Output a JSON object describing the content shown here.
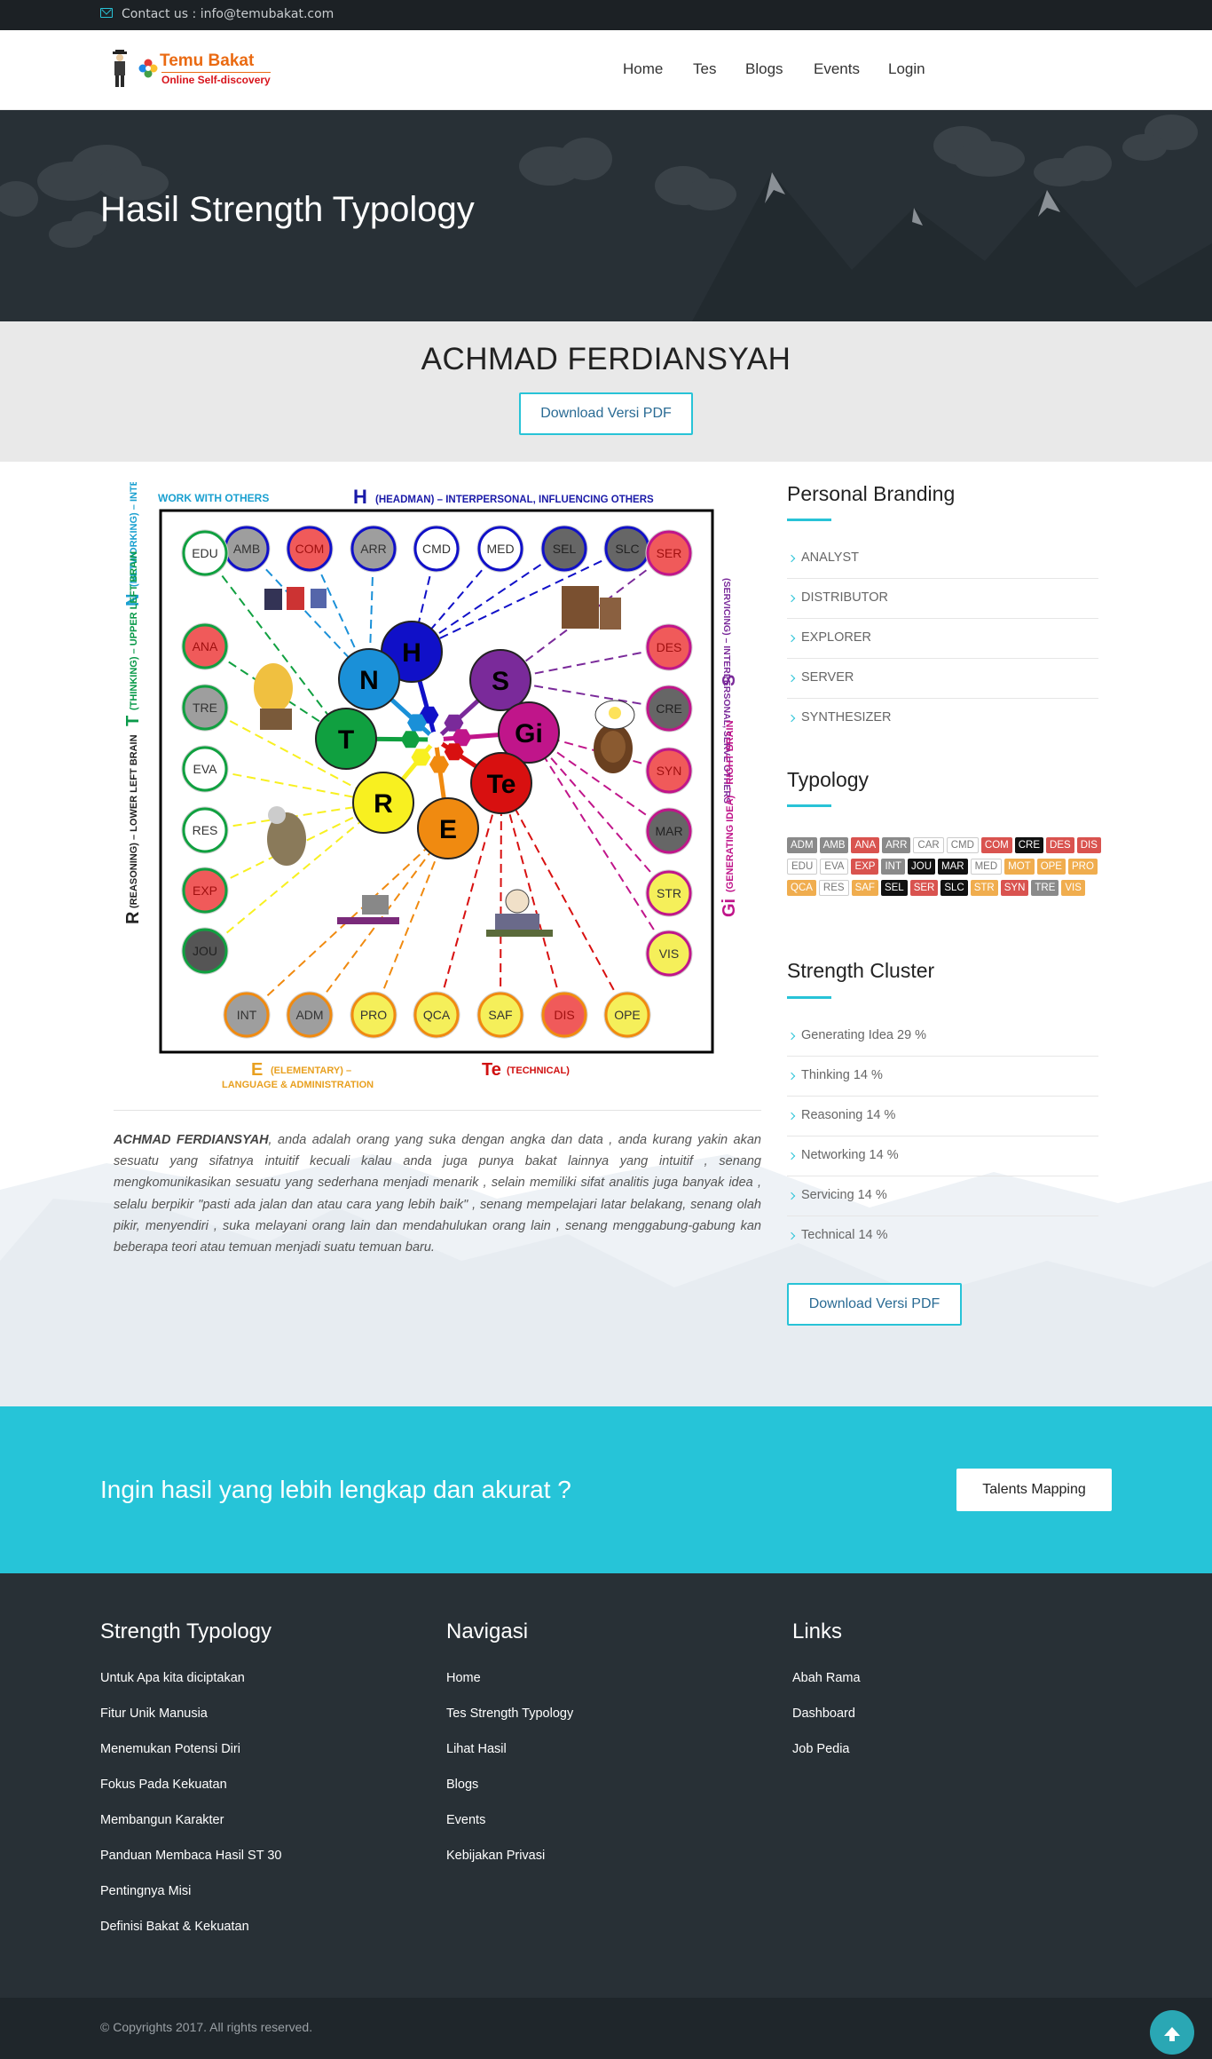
{
  "topbar": {
    "contact": "Contact us : info@temubakat.com"
  },
  "brand": {
    "name": "Temu Bakat",
    "tagline": "Online Self-discovery"
  },
  "nav": {
    "home": "Home",
    "tes": "Tes",
    "blogs": "Blogs",
    "events": "Events",
    "login": "Login"
  },
  "hero": {
    "title": "Hasil Strength Typology"
  },
  "result": {
    "name": "ACHMAD FERDIANSYAH",
    "download_label": "Download Versi PDF"
  },
  "diagram": {
    "label_top_letter": "H",
    "label_top": "(HEADMAN) – INTERPERSONAL, INFLUENCING OTHERS",
    "label_work": "WORK WITH OTHERS",
    "label_left_n": "N",
    "label_left_n_text": "(NETWORKING) – INTERPERSONAL",
    "label_left_t": "T",
    "label_left_t_text": "(THINKING) – UPPER LEFT BRAIN",
    "label_left_r": "R",
    "label_left_r_text": "(REASONING) – LOWER LEFT BRAIN",
    "label_right_s": "S",
    "label_right_s_text": "(SERVICING) – INTERPERSONAL, SERVE OTHERS",
    "label_right_gi": "Gi",
    "label_right_gi_text": "(GENERATING IDEA) – RIGHT BRAIN",
    "label_bottom_e": "E",
    "label_bottom_e_text": "(ELEMENTARY) –",
    "label_bottom_e_text2": "LANGUAGE & ADMINISTRATION",
    "label_bottom_te": "Te",
    "label_bottom_te_text": "(TECHNICAL)",
    "hub": [
      "H",
      "S",
      "Gi",
      "Te",
      "E",
      "R",
      "T",
      "N"
    ],
    "top_row": [
      "AMB",
      "COM",
      "ARR",
      "CMD",
      "MED",
      "SEL",
      "SLC"
    ],
    "left_col": [
      "EDU",
      "ANA",
      "TRE",
      "EVA",
      "RES",
      "EXP",
      "JOU"
    ],
    "right_col": [
      "SER",
      "DES",
      "CRE",
      "SYN",
      "MAR",
      "STR",
      "VIS"
    ],
    "bottom_row": [
      "INT",
      "ADM",
      "PRO",
      "QCA",
      "SAF",
      "DIS",
      "OPE"
    ]
  },
  "description": {
    "name": "ACHMAD FERDIANSYAH",
    "text": ", anda adalah orang yang suka dengan angka dan data , anda kurang yakin akan sesuatu yang sifatnya intuitif kecuali kalau anda juga punya bakat lainnya yang intuitif , senang mengkomunikasikan sesuatu yang sederhana menjadi menarik , selain memiliki sifat analitis juga banyak idea , selalu berpikir \"pasti ada jalan dan atau cara yang lebih baik\" , senang mempelajari latar belakang, senang olah pikir, menyendiri , suka melayani orang lain dan mendahulukan orang lain , senang menggabung-gabung kan beberapa teori atau temuan menjadi suatu temuan baru."
  },
  "sidebar": {
    "personal_branding_title": "Personal Branding",
    "personal_branding": [
      "ANALYST",
      "DISTRIBUTOR",
      "EXPLORER",
      "SERVER",
      "SYNTHESIZER"
    ],
    "typology_title": "Typology",
    "typology": [
      {
        "code": "ADM",
        "color": "#8a8a8a"
      },
      {
        "code": "AMB",
        "color": "#8a8a8a"
      },
      {
        "code": "ANA",
        "color": "#d9534f"
      },
      {
        "code": "ARR",
        "color": "#8a8a8a"
      },
      {
        "code": "CAR",
        "color": "#ffffff"
      },
      {
        "code": "CMD",
        "color": "#ffffff"
      },
      {
        "code": "COM",
        "color": "#d9534f"
      },
      {
        "code": "CRE",
        "color": "#111111"
      },
      {
        "code": "DES",
        "color": "#d9534f"
      },
      {
        "code": "DIS",
        "color": "#d9534f"
      },
      {
        "code": "EDU",
        "color": "#ffffff"
      },
      {
        "code": "EVA",
        "color": "#ffffff"
      },
      {
        "code": "EXP",
        "color": "#d9534f"
      },
      {
        "code": "INT",
        "color": "#8a8a8a"
      },
      {
        "code": "JOU",
        "color": "#111111"
      },
      {
        "code": "MAR",
        "color": "#111111"
      },
      {
        "code": "MED",
        "color": "#ffffff"
      },
      {
        "code": "MOT",
        "color": "#f0ad4e"
      },
      {
        "code": "OPE",
        "color": "#f0ad4e"
      },
      {
        "code": "PRO",
        "color": "#f0ad4e"
      },
      {
        "code": "QCA",
        "color": "#f0ad4e"
      },
      {
        "code": "RES",
        "color": "#ffffff"
      },
      {
        "code": "SAF",
        "color": "#f0ad4e"
      },
      {
        "code": "SEL",
        "color": "#111111"
      },
      {
        "code": "SER",
        "color": "#d9534f"
      },
      {
        "code": "SLC",
        "color": "#111111"
      },
      {
        "code": "STR",
        "color": "#f0ad4e"
      },
      {
        "code": "SYN",
        "color": "#d9534f"
      },
      {
        "code": "TRE",
        "color": "#8a8a8a"
      },
      {
        "code": "VIS",
        "color": "#f0ad4e"
      }
    ],
    "cluster_title": "Strength Cluster",
    "cluster": [
      "Generating Idea 29 %",
      "Thinking 14 %",
      "Reasoning 14 %",
      "Networking 14 %",
      "Servicing 14 %",
      "Technical 14 %"
    ],
    "download_label": "Download Versi PDF"
  },
  "cta": {
    "text": "Ingin hasil yang lebih lengkap dan akurat ?",
    "button": "Talents Mapping"
  },
  "footer": {
    "col1_title": "Strength Typology",
    "col1": [
      "Untuk Apa kita diciptakan",
      "Fitur Unik Manusia",
      "Menemukan Potensi Diri",
      "Fokus Pada Kekuatan",
      "Membangun Karakter",
      "Panduan Membaca Hasil ST 30",
      "Pentingnya Misi",
      "Definisi Bakat & Kekuatan"
    ],
    "col2_title": "Navigasi",
    "col2": [
      "Home",
      "Tes Strength Typology",
      "Lihat Hasil",
      "Blogs",
      "Events",
      "Kebijakan Privasi"
    ],
    "col3_title": "Links",
    "col3": [
      "Abah Rama",
      "Dashboard",
      "Job Pedia"
    ],
    "copyright": "© Copyrights 2017. All rights reserved."
  }
}
